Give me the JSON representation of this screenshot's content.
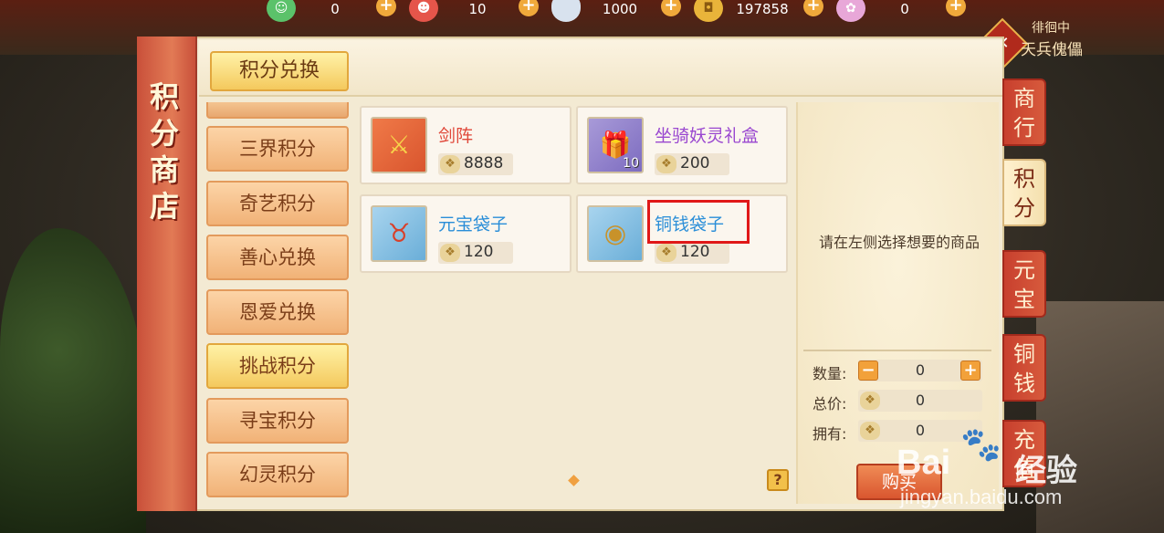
{
  "currencies": [
    {
      "icon": "green-spirit-icon",
      "value": "0",
      "color": "#5bc26a"
    },
    {
      "icon": "red-spirit-icon",
      "value": "10",
      "color": "#e5554a"
    },
    {
      "icon": "silver-ingot-icon",
      "value": "1000",
      "color": "#d8e2ee"
    },
    {
      "icon": "copper-coin-icon",
      "value": "197858",
      "color": "#e9b43a"
    },
    {
      "icon": "pink-pet-icon",
      "value": "0",
      "color": "#e8a7d8"
    }
  ],
  "status": {
    "line1": "徘徊中",
    "line2": "天兵傀儡"
  },
  "shop_title": "积分商店",
  "main_tab": "积分兑换",
  "menu": [
    {
      "label": "三界积分",
      "active": false
    },
    {
      "label": "奇艺积分",
      "active": false
    },
    {
      "label": "善心兑换",
      "active": false
    },
    {
      "label": "恩爱兑换",
      "active": false
    },
    {
      "label": "挑战积分",
      "active": true
    },
    {
      "label": "寻宝积分",
      "active": false
    },
    {
      "label": "幻灵积分",
      "active": false
    }
  ],
  "items": [
    {
      "name": "剑阵",
      "price": "8888",
      "qty": "",
      "icon": "sword-array-icon"
    },
    {
      "name": "坐骑妖灵礼盒",
      "price": "200",
      "qty": "10",
      "icon": "mount-gift-box-icon"
    },
    {
      "name": "元宝袋子",
      "price": "120",
      "qty": "",
      "icon": "ingot-bag-icon"
    },
    {
      "name": "铜钱袋子",
      "price": "120",
      "qty": "",
      "icon": "coin-bag-icon"
    }
  ],
  "detail": {
    "message": "请在左侧选择想要的商品",
    "qty_label": "数量:",
    "qty_value": "0",
    "total_label": "总价:",
    "total_value": "0",
    "own_label": "拥有:",
    "own_value": "0",
    "buy_label": "购买",
    "help": "?"
  },
  "side_tabs": [
    {
      "label1": "商",
      "label2": "行",
      "active": false
    },
    {
      "label1": "积",
      "label2": "分",
      "active": true
    },
    {
      "label1": "元",
      "label2": "宝",
      "active": false
    },
    {
      "label1": "铜",
      "label2": "钱",
      "active": false
    },
    {
      "label1": "充",
      "label2": "值",
      "active": false
    }
  ],
  "watermark": {
    "brand": "Bai",
    "brand2": "经验",
    "url": "jingyan.baidu.com"
  }
}
